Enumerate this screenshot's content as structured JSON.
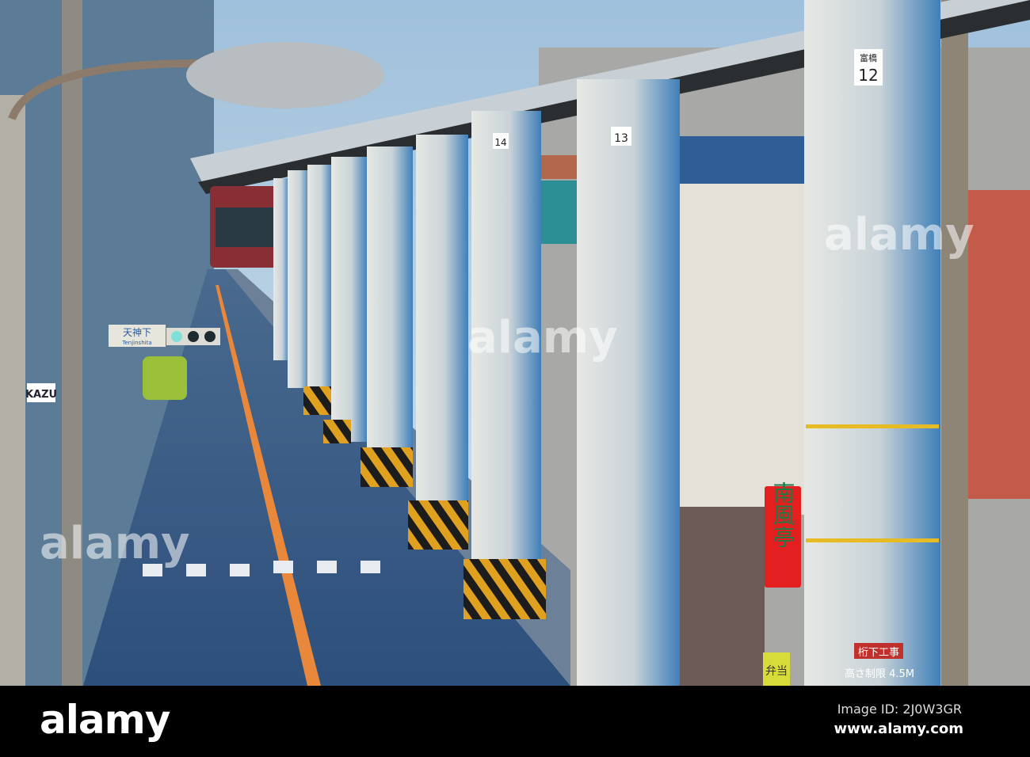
{
  "photo": {
    "signs": {
      "place_name_jp": "天神下",
      "place_name_en": "Tenjinshita",
      "pillar_numbers": [
        "12",
        "13",
        "14"
      ],
      "pillar_label": "富橋",
      "clearance_warning": "桁下工事",
      "clearance_height": "高さ制限 4.5M",
      "restaurant_sign": "南風亭",
      "bento_sign": "弁当",
      "shop_sign_partial": "KAZU"
    },
    "watermarks": [
      "alamy",
      "alamy",
      "alamy",
      "alamy"
    ]
  },
  "footer": {
    "logo": "alamy",
    "image_id": "Image ID: 2J0W3GR",
    "website": "www.alamy.com"
  }
}
